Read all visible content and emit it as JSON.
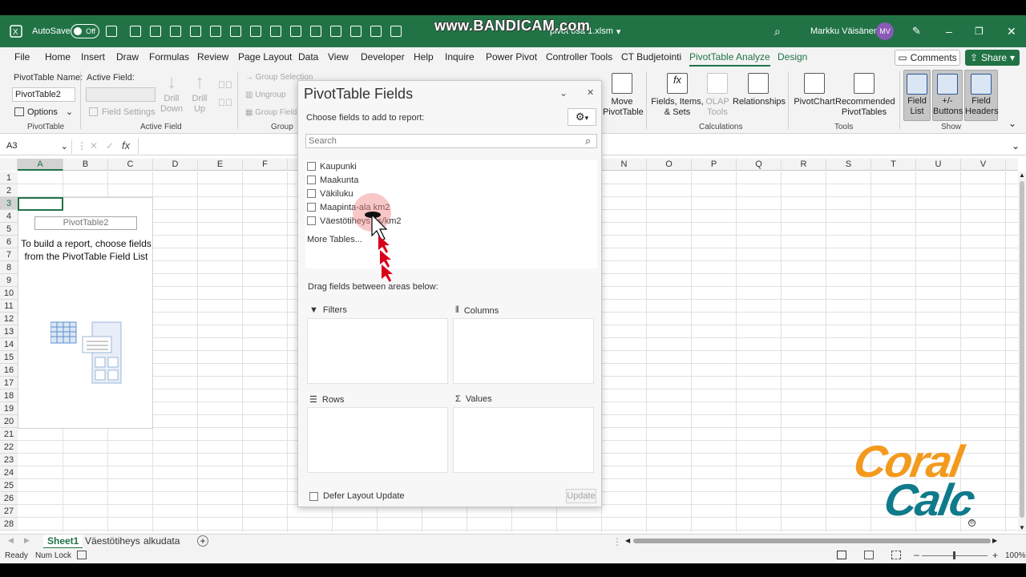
{
  "recorder_watermark": "www.BANDICAM.com",
  "titlebar": {
    "autosave_label": "AutoSave",
    "autosave_state": "Off",
    "filename": "pivot osa 1.xlsm",
    "user_name": "Markku Väisänen",
    "user_initials": "MV"
  },
  "menu": {
    "items": [
      "File",
      "Home",
      "Insert",
      "Draw",
      "Formulas",
      "Review",
      "Page Layout",
      "Data",
      "View",
      "Developer",
      "Help",
      "Inquire",
      "Power Pivot",
      "Controller Tools",
      "CT Budjetointi",
      "PivotTable Analyze",
      "Design"
    ],
    "comments_label": "Comments",
    "share_label": "Share"
  },
  "ribbon": {
    "pivottable_name_label": "PivotTable Name:",
    "pivottable_name_value": "PivotTable2",
    "options_label": "Options",
    "group_pivottable": "PivotTable",
    "active_field_label": "Active Field:",
    "field_settings_label": "Field Settings",
    "drill_down_label": "Drill Down",
    "drill_up_label": "Drill Up",
    "group_active_field": "Active Field",
    "group_selection_label": "Group Selection",
    "ungroup_label": "Ungroup",
    "group_field_label": "Group Field",
    "group_group": "Group",
    "move_pivottable_label": "Move PivotTable",
    "fields_items_sets_label": "Fields, Items, & Sets",
    "olap_tools_label": "OLAP Tools",
    "relationships_label": "Relationships",
    "group_calculations": "Calculations",
    "pivotchart_label": "PivotChart",
    "recommended_label": "Recommended PivotTables",
    "group_tools": "Tools",
    "field_list_label": "Field List",
    "buttons_label": "+/- Buttons",
    "field_headers_label": "Field Headers",
    "group_show": "Show"
  },
  "formula_bar": {
    "name_box": "A3",
    "fx": "fx",
    "content": ""
  },
  "grid": {
    "columns": [
      "A",
      "B",
      "C",
      "D",
      "E",
      "F",
      "G",
      "H",
      "I",
      "J",
      "K",
      "L",
      "M",
      "N",
      "O",
      "P",
      "Q",
      "R",
      "S",
      "T",
      "U",
      "V"
    ],
    "rows": [
      "1",
      "2",
      "3",
      "4",
      "5",
      "6",
      "7",
      "8",
      "9",
      "10",
      "11",
      "12",
      "13",
      "14",
      "15",
      "16",
      "17",
      "18",
      "19",
      "20",
      "21",
      "22",
      "23",
      "24",
      "25",
      "26",
      "27",
      "28"
    ],
    "selected_cell": "A3"
  },
  "pivot_placeholder": {
    "name": "PivotTable2",
    "hint": "To build a report, choose fields from the PivotTable Field List"
  },
  "task_pane": {
    "title": "PivotTable Fields",
    "choose_label": "Choose fields to add to report:",
    "search_placeholder": "Search",
    "fields": [
      "Kaupunki",
      "Maakunta",
      "Väkiluku",
      "Maapinta-ala km2",
      "Väestötiheys as/km2"
    ],
    "more_tables": "More Tables...",
    "drag_label": "Drag fields between areas below:",
    "areas": {
      "filters": "Filters",
      "columns": "Columns",
      "rows": "Rows",
      "values": "Values"
    },
    "defer_label": "Defer Layout Update",
    "update_label": "Update"
  },
  "sheets": {
    "tabs": [
      "Sheet1",
      "Väestötiheys",
      "alkudata"
    ],
    "active": "Sheet1"
  },
  "status": {
    "ready": "Ready",
    "num_lock": "Num Lock",
    "zoom": "100%"
  },
  "logo": {
    "line1": "Coral",
    "line2": "Calc",
    "color_top": "#f39a1e",
    "color_bottom": "#0f7a8a"
  },
  "colors": {
    "excel_green": "#217346",
    "cursor_red": "#d9001b"
  }
}
